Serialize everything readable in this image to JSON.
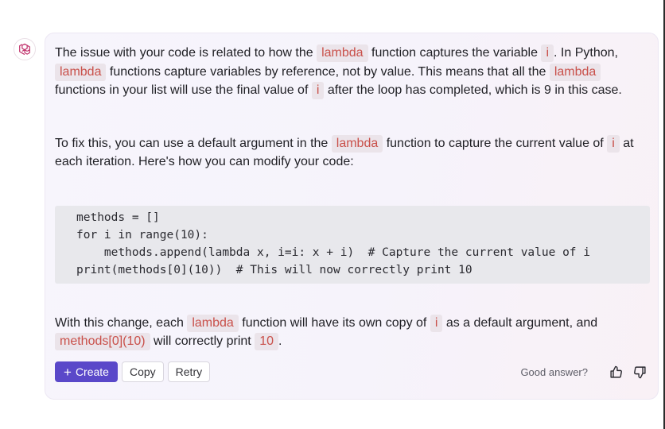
{
  "message": {
    "p1": {
      "t1": "The issue with your code is related to how the ",
      "c1": "lambda",
      "t2": " function captures the variable ",
      "c2": "i",
      "t3": ". In Python, ",
      "c3": "lambda",
      "t4": " functions capture variables by reference, not by value. This means that all the ",
      "c4": "lambda",
      "t5": " functions in your list will use the final value of ",
      "c5": "i",
      "t6": " after the loop has completed, which is 9 in this case."
    },
    "p2": {
      "t1": "To fix this, you can use a default argument in the ",
      "c1": "lambda",
      "t2": " function to capture the current value of ",
      "c2": "i",
      "t3": " at each iteration. Here's how you can modify your code:"
    },
    "code_lines": [
      "methods = []",
      "for i in range(10):",
      "    methods.append(lambda x, i=i: x + i)  # Capture the current value of i",
      "print(methods[0](10))  # This will now correctly print 10"
    ],
    "p4": {
      "t1": "With this change, each ",
      "c1": "lambda",
      "t2": " function will have its own copy of ",
      "c2": "i",
      "t3": " as a default argument, and ",
      "c3": "methods[0](10)",
      "t4": " will correctly print ",
      "c4": "10",
      "t5": "."
    }
  },
  "actions": {
    "create_plus": "+",
    "create_label": "Create",
    "copy_label": "Copy",
    "retry_label": "Retry",
    "feedback_label": "Good answer?"
  },
  "icons": {
    "avatar": "openai-logo-icon",
    "thumbs_up": "thumbs-up-icon",
    "thumbs_down": "thumbs-down-icon"
  },
  "colors": {
    "accent": "#5a48c9",
    "inline_code_text": "#c9504a",
    "inline_code_bg": "#ebe4ea",
    "code_block_bg": "#e8e8ec"
  }
}
